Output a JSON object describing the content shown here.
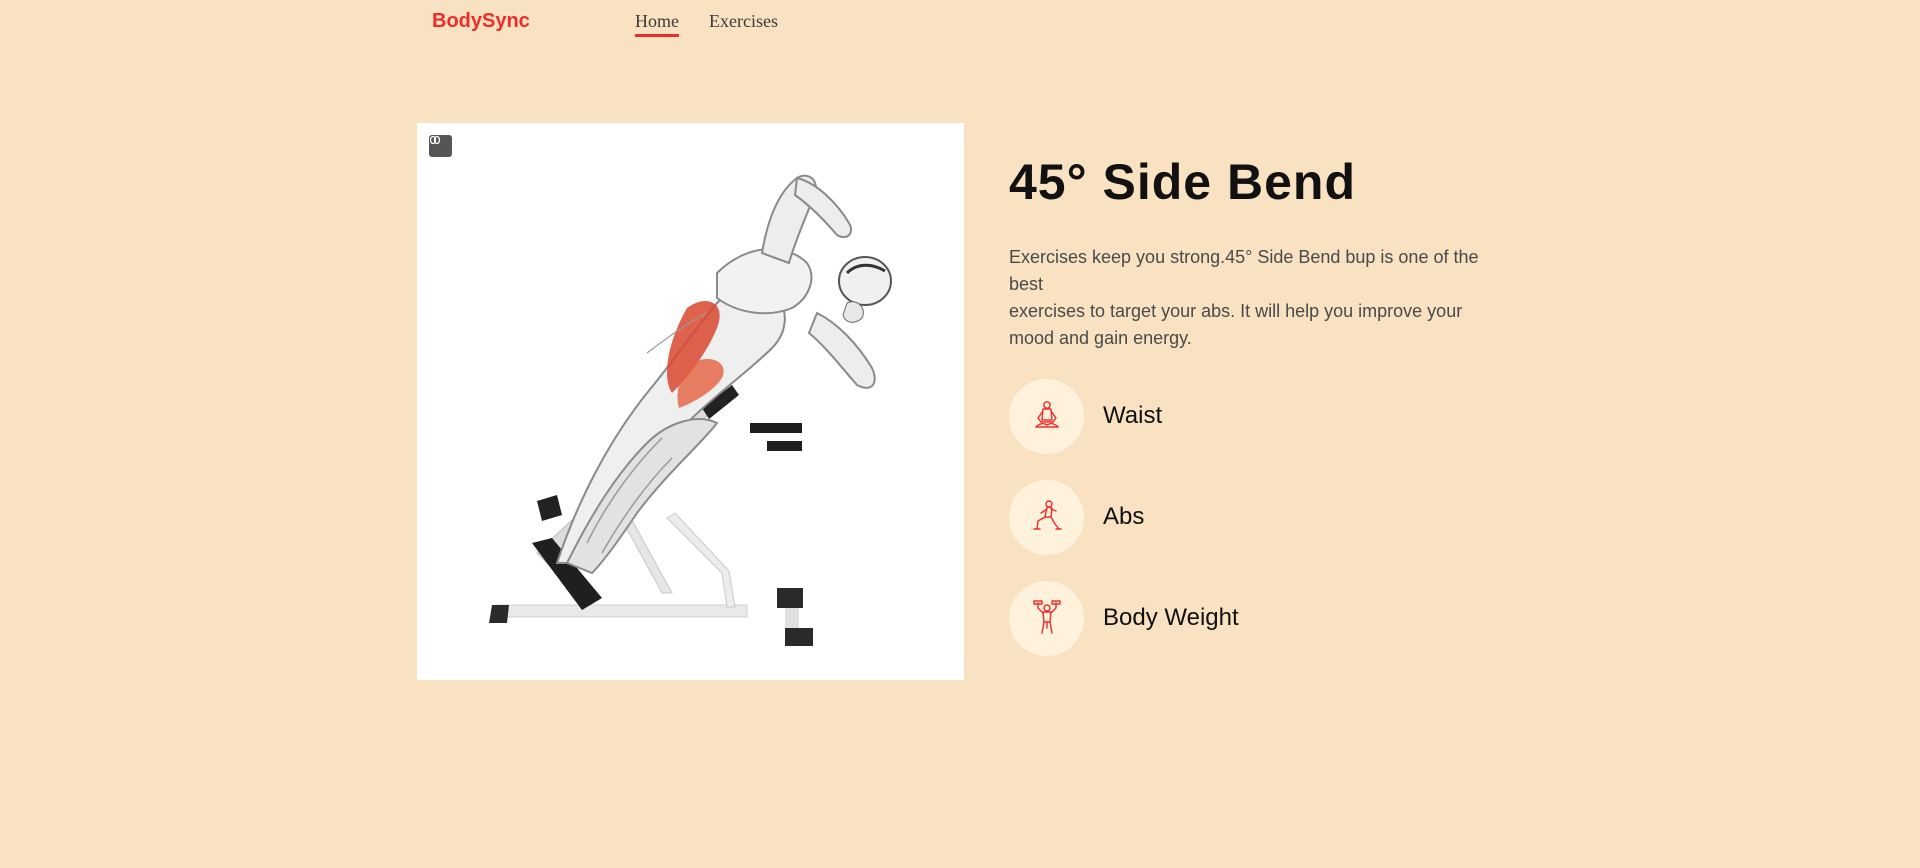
{
  "nav": {
    "logo": "BodySync",
    "links": [
      {
        "label": "Home",
        "active": true
      },
      {
        "label": "Exercises",
        "active": false
      }
    ]
  },
  "exercise": {
    "title": "45° Side Bend",
    "description_lines": [
      "Exercises keep you strong.45° Side Bend bup is one of the best",
      "exercises to target your abs. It will help you improve your mood and gain energy."
    ],
    "tags": [
      {
        "label": "Waist",
        "icon": "meditation-icon"
      },
      {
        "label": "Abs",
        "icon": "lunge-icon"
      },
      {
        "label": "Body Weight",
        "icon": "dumbbell-lift-icon"
      }
    ]
  },
  "colors": {
    "background": "#f8e2c1",
    "accent": "#ee2c2c",
    "icon_circle": "#fff2dc"
  }
}
